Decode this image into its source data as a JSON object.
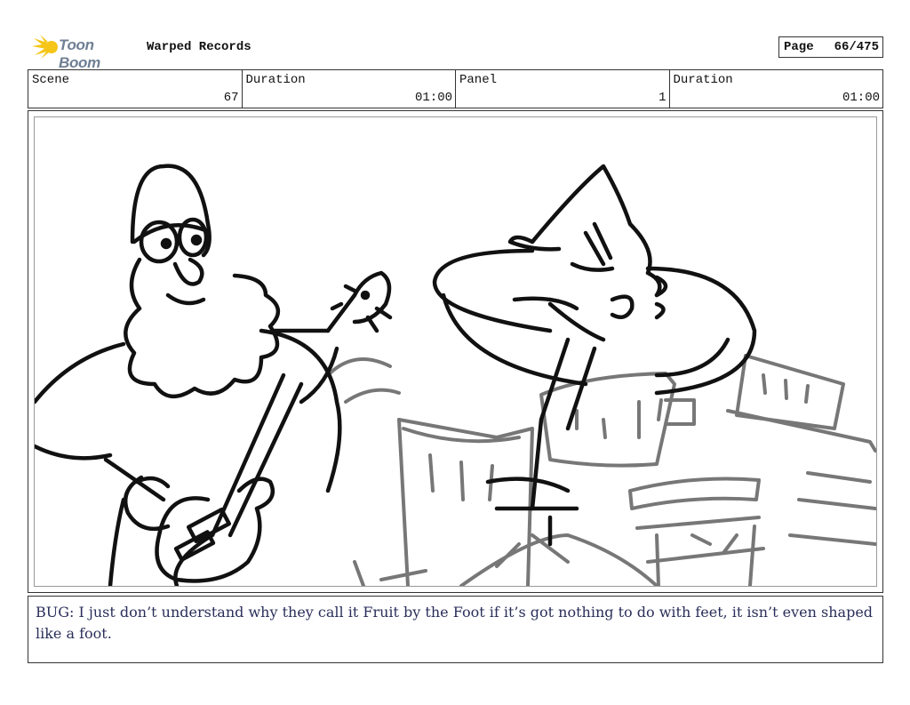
{
  "header": {
    "logo_text": "Toon Boom",
    "project_title": "Warped Records",
    "page_label": "Page",
    "page_value": "66/475"
  },
  "meta": [
    {
      "label": "Scene",
      "value": "67"
    },
    {
      "label": "Duration",
      "value": "01:00"
    },
    {
      "label": "Panel",
      "value": "1"
    },
    {
      "label": "Duration",
      "value": "01:00"
    }
  ],
  "dialogue": "BUG: I just don’t understand why they call it Fruit by the Foot if it’s got nothing to do with feet, it isn’t even shaped like a foot.",
  "colors": {
    "logo_yellow": "#f5c518",
    "logo_gray": "#6f7f94",
    "dialogue_text": "#2a2f5a",
    "sketch_line": "#111111",
    "sketch_gray": "#777777"
  }
}
